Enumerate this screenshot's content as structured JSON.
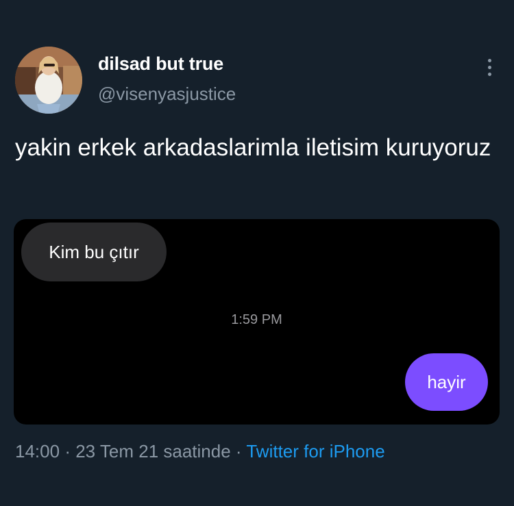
{
  "user": {
    "display_name": "dilsad but true",
    "handle": "@visenyasjustice"
  },
  "tweet": {
    "text": "yakin erkek arkadaslarimla iletisim kuruyoruz"
  },
  "chat": {
    "incoming_message": "Kim bu çıtır",
    "timestamp": "1:59 PM",
    "outgoing_message": "hayir",
    "outgoing_bubble_color": "#7c4dff",
    "incoming_bubble_color": "#2a2a2c"
  },
  "meta": {
    "time": "14:00",
    "separator": "·",
    "date": "23 Tem 21 saatinde",
    "source": "Twitter for iPhone"
  },
  "icons": {
    "more": "more-vertical-icon"
  },
  "colors": {
    "background": "#15202b",
    "muted_text": "#8b98a5",
    "link": "#1d9bf0"
  }
}
